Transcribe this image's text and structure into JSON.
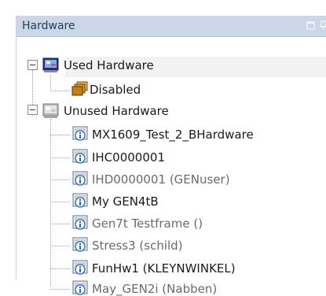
{
  "panel": {
    "title": "Hardware",
    "buttons": [
      "maximize-icon",
      "pin-icon"
    ]
  },
  "tree": {
    "used": {
      "label": "Used Hardware",
      "icon": "hardware-group-used-icon",
      "expanded": true,
      "children": [
        {
          "label": "Disabled",
          "icon": "disabled-folder-icon"
        }
      ]
    },
    "unused": {
      "label": "Unused Hardware",
      "icon": "hardware-group-unused-icon",
      "expanded": true,
      "children": [
        {
          "label": "MX1609_Test_2_BHardware",
          "icon": "device-info-icon",
          "dim": false
        },
        {
          "label": "IHC0000001",
          "icon": "device-info-icon",
          "dim": false
        },
        {
          "label": "IHD0000001 (GENuser)",
          "icon": "device-info-icon",
          "dim": true
        },
        {
          "label": "My GEN4tB",
          "icon": "device-info-icon",
          "dim": false
        },
        {
          "label": "Gen7t Testframe ()",
          "icon": "device-info-icon",
          "dim": true
        },
        {
          "label": "Stress3 (schild)",
          "icon": "device-info-icon",
          "dim": true
        },
        {
          "label": "FunHw1 (KLEYNWINKEL)",
          "icon": "device-info-icon",
          "dim": false
        },
        {
          "label": "May_GEN2i (Nabben)",
          "icon": "device-info-icon",
          "dim": true
        }
      ]
    }
  },
  "colors": {
    "header_bg": "#cbd7e8",
    "dim_text": "#6a6a6a",
    "text": "#1a1a1a"
  }
}
